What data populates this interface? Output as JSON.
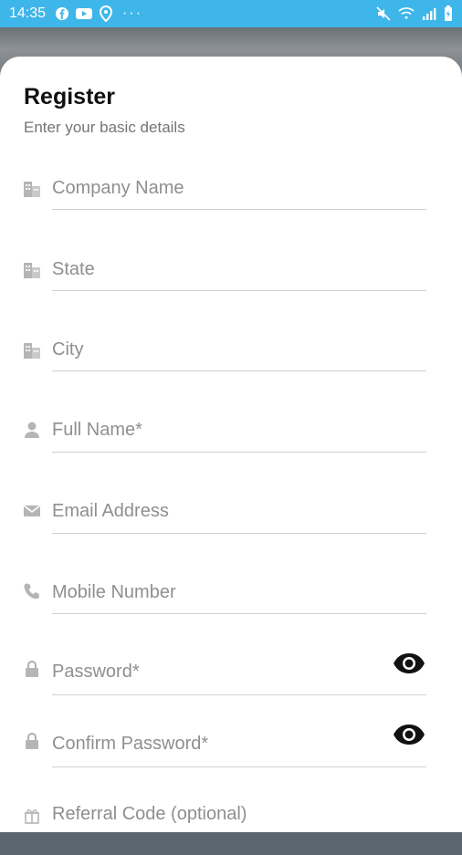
{
  "status_bar": {
    "time": "14:35",
    "left_icons": [
      "facebook-icon",
      "youtube-icon",
      "maps-icon"
    ],
    "overflow": "···",
    "right_icons": [
      "mute-icon",
      "wifi-icon",
      "signal-icon",
      "battery-icon"
    ]
  },
  "form": {
    "title": "Register",
    "subtitle": "Enter your basic details",
    "fields": [
      {
        "label": "Company Name",
        "icon": "building-icon"
      },
      {
        "label": "State",
        "icon": "building-icon"
      },
      {
        "label": "City",
        "icon": "building-icon"
      },
      {
        "label": "Full Name*",
        "icon": "person-icon"
      },
      {
        "label": "Email Address",
        "icon": "envelope-icon"
      },
      {
        "label": "Mobile Number",
        "icon": "phone-icon"
      },
      {
        "label": "Password*",
        "icon": "lock-icon",
        "toggle": "eye-icon"
      },
      {
        "label": "Confirm Password*",
        "icon": "lock-icon",
        "toggle": "eye-icon"
      },
      {
        "label": "Referral Code (optional)",
        "icon": "gift-icon"
      }
    ]
  },
  "colors": {
    "status_bar": "#3fb6ea",
    "title": "#111111",
    "placeholder": "#8f8f8f",
    "icon": "#b5b5b5",
    "underline": "#d0d0d0"
  }
}
